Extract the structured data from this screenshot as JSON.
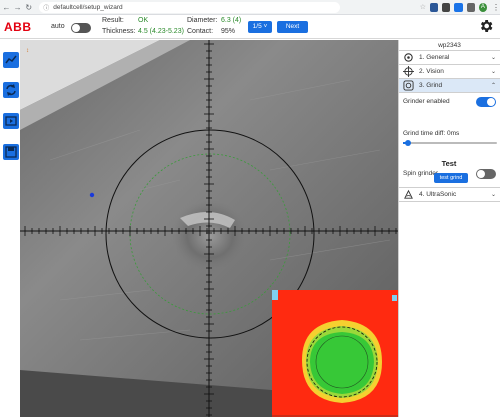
{
  "browser": {
    "url": "defaultcell/setup_wizard",
    "back_icon": "arrow-left-icon",
    "forward_icon": "arrow-right-icon",
    "reload_icon": "reload-icon",
    "profile_initial": "A"
  },
  "header": {
    "logo": "ABB",
    "auto_label": "auto",
    "auto_enabled": false,
    "result_label": "Result:",
    "result_value": "OK",
    "thickness_label": "Thickness:",
    "thickness_value": "4.5 (4.23-5.23)",
    "diameter_label": "Diameter:",
    "diameter_value": "6.3 (4)",
    "contact_label": "Contact:",
    "contact_value": "95%",
    "page_select": "1/5",
    "next_label": "Next",
    "accent_color": "#1a6fe0",
    "ok_color": "#2a8a2a"
  },
  "toolbar": {
    "items": [
      "chart-line-icon",
      "sync-icon",
      "video-icon",
      "save-icon"
    ]
  },
  "panel": {
    "title": "wp2343",
    "sections": [
      {
        "label": "1. General",
        "icon": "gear-icon",
        "expanded": false
      },
      {
        "label": "2. Vision",
        "icon": "crosshair-icon",
        "expanded": false
      },
      {
        "label": "3. Grind",
        "icon": "grind-icon",
        "expanded": true
      },
      {
        "label": "4. UltraSonic",
        "icon": "ultrasonic-icon",
        "expanded": false
      }
    ],
    "grind": {
      "grinder_enabled_label": "Grinder enabled",
      "grinder_enabled": true,
      "time_diff_label": "Grind time diff: 0ms",
      "time_diff_fraction": 0.05,
      "test_title": "Test",
      "spin_label": "Spin grinder",
      "spin_enabled": false,
      "test_button": "test grind"
    }
  }
}
